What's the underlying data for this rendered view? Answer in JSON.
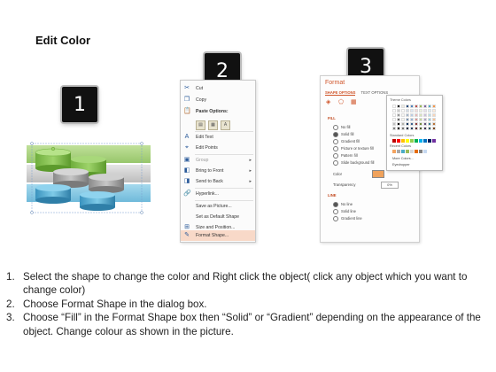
{
  "title": "Edit Color",
  "badges": [
    "1",
    "2",
    "3"
  ],
  "context_menu": {
    "items": [
      {
        "icon": "scissors-icon",
        "glyph": "✂",
        "label": "Cut"
      },
      {
        "icon": "copy-icon",
        "glyph": "❐",
        "label": "Copy"
      },
      {
        "icon": "paste-icon",
        "glyph": "📋",
        "label": "Paste Options:"
      },
      {
        "icon": "edit-text-icon",
        "glyph": "A",
        "label": "Edit Text"
      },
      {
        "icon": "edit-points-icon",
        "glyph": "⌖",
        "label": "Edit Points"
      },
      {
        "icon": "group-icon",
        "glyph": "▣",
        "label": "Group"
      },
      {
        "icon": "bring-front-icon",
        "glyph": "◧",
        "label": "Bring to Front"
      },
      {
        "icon": "send-back-icon",
        "glyph": "◨",
        "label": "Send to Back"
      },
      {
        "icon": "hyperlink-icon",
        "glyph": "🔗",
        "label": "Hyperlink..."
      },
      {
        "icon": "",
        "glyph": "",
        "label": "Save as Picture..."
      },
      {
        "icon": "",
        "glyph": "",
        "label": "Set as Default Shape"
      },
      {
        "icon": "size-icon",
        "glyph": "⊞",
        "label": "Size and Position..."
      },
      {
        "icon": "format-shape-icon",
        "glyph": "✎",
        "label": "Format Shape..."
      }
    ]
  },
  "format_pane": {
    "title": "Format",
    "tabs": [
      "SHAPE OPTIONS",
      "TEXT OPTIONS"
    ],
    "fill_section": "FILL",
    "fill_options": [
      "No fill",
      "Solid fill",
      "Gradient fill",
      "Picture or texture fill",
      "Pattern fill",
      "Slide background fill"
    ],
    "color_label": "Color",
    "transparency_label": "Transparency",
    "transparency_value": "0%",
    "line_section": "LINE",
    "line_options": [
      "No line",
      "Solid line",
      "Gradient line"
    ]
  },
  "color_popup": {
    "theme_label": "Theme Colors",
    "standard_label": "Standard Colors",
    "recent_label": "Recent Colors",
    "more_colors": "More Colors...",
    "eyedropper": "Eyedropper",
    "theme_colors": [
      "#ffffff",
      "#000000",
      "#eeece1",
      "#1f497d",
      "#4f81bd",
      "#c0504d",
      "#9bbb59",
      "#8064a2",
      "#4bacc6",
      "#f79646"
    ],
    "standard_colors": [
      "#c00000",
      "#ff0000",
      "#ffc000",
      "#ffff00",
      "#92d050",
      "#00b050",
      "#00b0f0",
      "#0070c0",
      "#002060",
      "#7030a0"
    ],
    "recent_colors": [
      "#f4a460",
      "#a9a9a9",
      "#4bacc6",
      "#9bbb59",
      "#d9d9d9",
      "#e46c0a",
      "#808080",
      "#c6d9f1"
    ]
  },
  "steps": [
    {
      "num": "1.",
      "text": "Select the shape to change the color and Right click the object( click any object which you want to change color)"
    },
    {
      "num": "2.",
      "text": "Choose Format Shape in the dialog box."
    },
    {
      "num": "3.",
      "text": "Choose “Fill” in the Format Shape box then “Solid” or “Gradient” depending on the appearance of the object. Change colour as shown in the picture."
    }
  ]
}
